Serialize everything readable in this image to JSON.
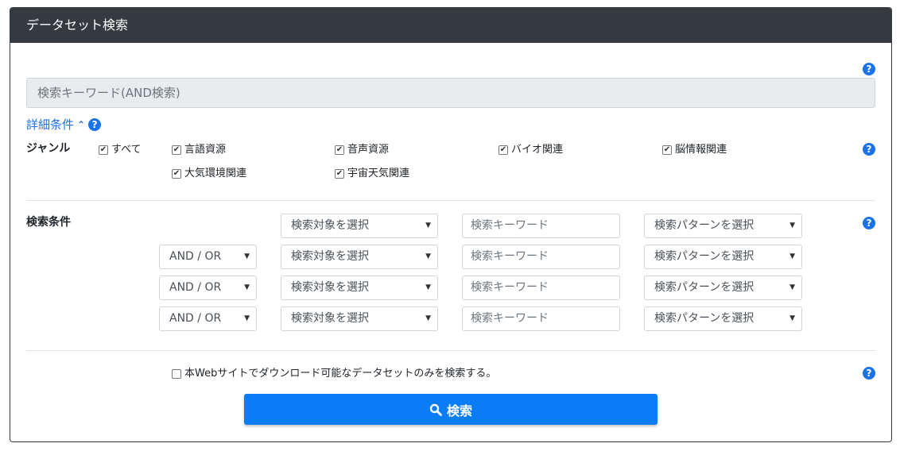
{
  "header": {
    "title": "データセット検索"
  },
  "keyword": {
    "placeholder": "検索キーワード(AND検索)"
  },
  "detail": {
    "label": "詳細条件",
    "chevron": "⌃"
  },
  "help": {
    "glyph": "?"
  },
  "genre": {
    "label": "ジャンル",
    "items": [
      {
        "label": "すべて",
        "checked": true
      },
      {
        "label": "言語資源",
        "checked": true
      },
      {
        "label": "音声資源",
        "checked": true
      },
      {
        "label": "バイオ関連",
        "checked": true
      },
      {
        "label": "脳情報関連",
        "checked": true
      },
      {
        "label": "大気環境関連",
        "checked": true
      },
      {
        "label": "宇宙天気関連",
        "checked": true
      }
    ]
  },
  "conditions": {
    "label": "検索条件",
    "andor_label": "AND / OR",
    "target_label": "検索対象を選択",
    "keyword_placeholder": "検索キーワード",
    "pattern_label": "検索パターンを選択"
  },
  "download_only": {
    "label": "本Webサイトでダウンロード可能なデータセットのみを検索する。",
    "checked": false
  },
  "search_button": {
    "label": "検索",
    "icon": "search-icon"
  },
  "colors": {
    "header_bg": "#343a40",
    "accent": "#0a7cf5",
    "link": "#1a73e8"
  }
}
